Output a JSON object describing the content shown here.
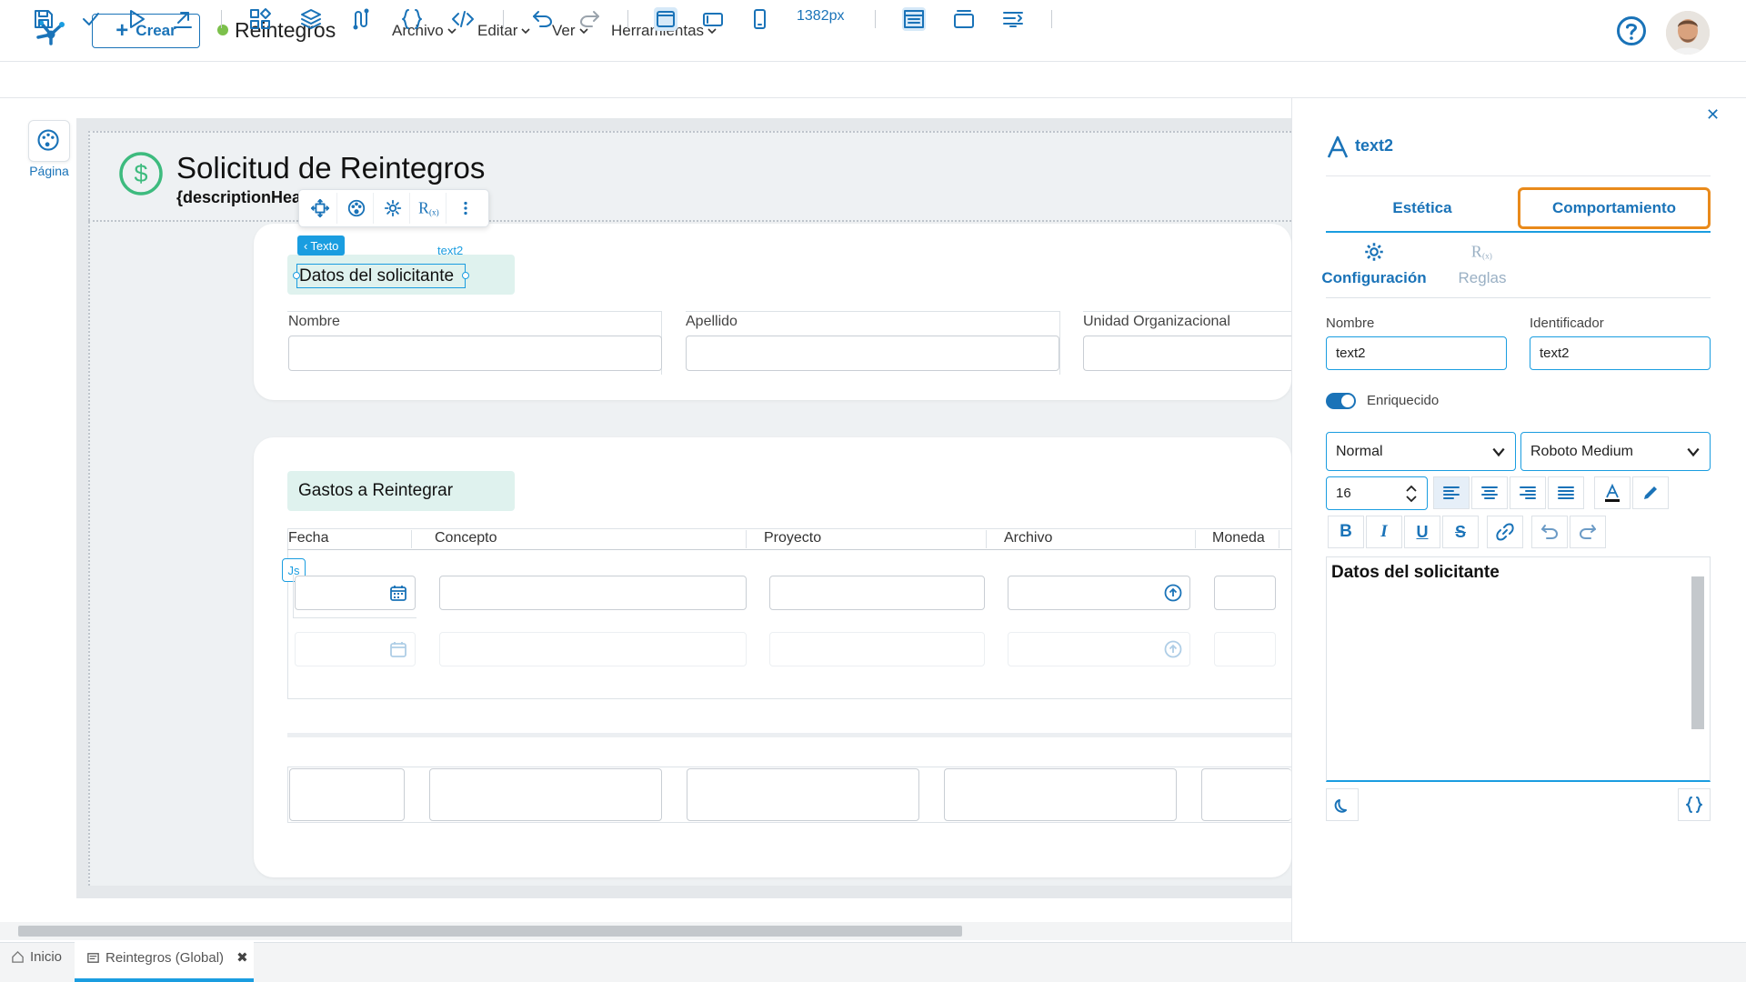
{
  "header": {
    "create_label": "Crear",
    "app_title": "Reintegros",
    "menus": [
      "Archivo",
      "Editar",
      "Ver",
      "Herramientas"
    ]
  },
  "toolbar": {
    "px_readout": "1382px"
  },
  "left_rail": {
    "page_label": "Página"
  },
  "form": {
    "title": "Solicitud de Reintegros",
    "subtitle": "{descriptionHea",
    "texto_tag": "Texto",
    "text2_tag": "text2",
    "section1": {
      "header": "Datos del solicitante",
      "fields": [
        "Nombre",
        "Apellido",
        "Unidad Organizacional"
      ]
    },
    "section2": {
      "header": "Gastos a Reintegrar",
      "columns": [
        "Fecha",
        "Concepto",
        "Proyecto",
        "Archivo",
        "Moneda"
      ],
      "js_badge": "Js"
    }
  },
  "panel": {
    "title": "text2",
    "tabs": [
      "Estética",
      "Comportamiento"
    ],
    "subtabs": [
      "Configuración",
      "Reglas"
    ],
    "nombre_label": "Nombre",
    "nombre_value": "text2",
    "identificador_label": "Identificador",
    "identificador_value": "text2",
    "toggle_label": "Enriquecido",
    "style_select": "Normal",
    "font_select": "Roboto Medium",
    "font_size": "16",
    "editor_text": "Datos del solicitante"
  },
  "bottom_tabs": {
    "home": "Inicio",
    "active": "Reintegros (Global)"
  },
  "colors": {
    "accent": "#1a73b8",
    "accent_light": "#1a9de0",
    "highlight_orange": "#e98a1b",
    "section_header_bg": "#dff2ee",
    "status_green": "#7cc04b"
  }
}
